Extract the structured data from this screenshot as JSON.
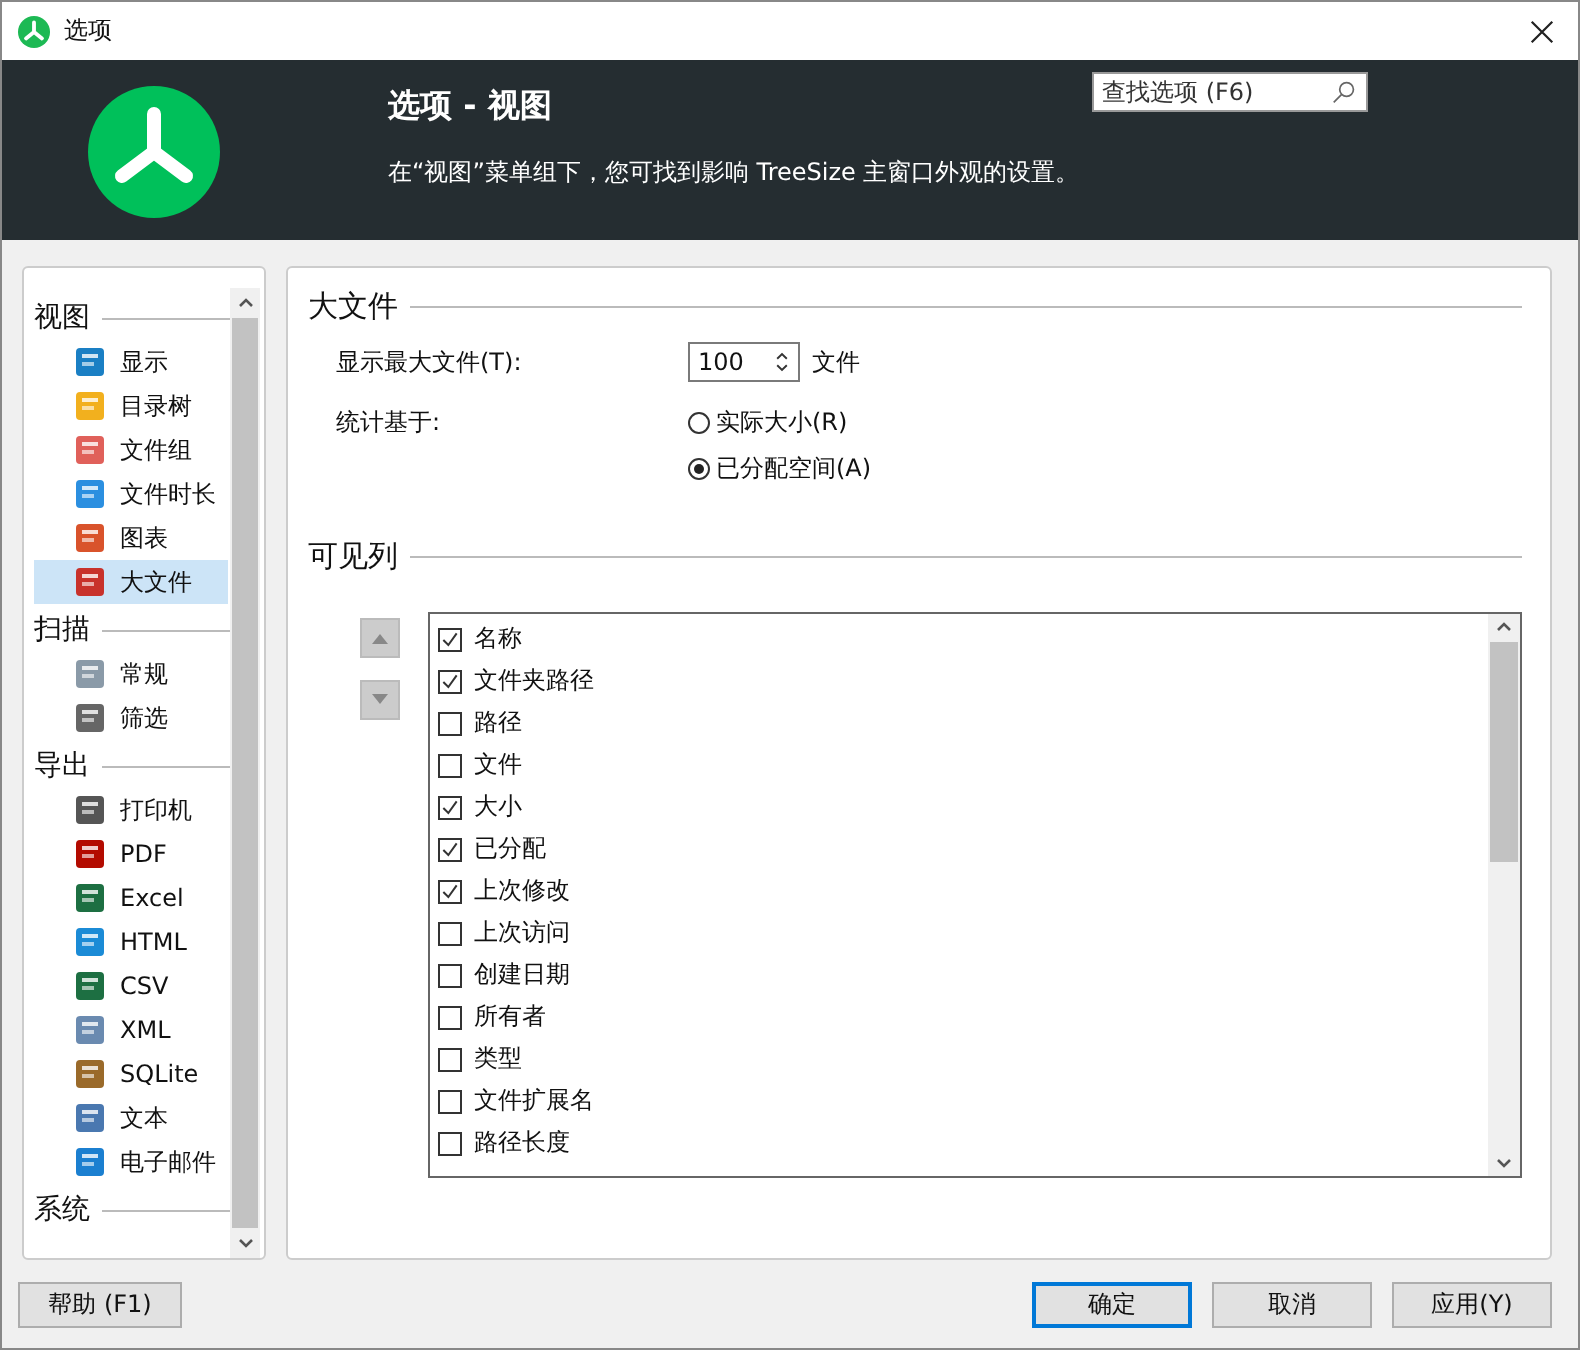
{
  "window": {
    "title": "选项"
  },
  "header": {
    "title": "选项 - 视图",
    "description": "在“视图”菜单组下，您可找到影响 TreeSize 主窗口外观的设置。",
    "search": {
      "placeholder": "查找选项 (F6)"
    }
  },
  "sidebar": {
    "groups": [
      {
        "label": "视图",
        "items": [
          {
            "label": "显示",
            "selected": false
          },
          {
            "label": "目录树",
            "selected": false
          },
          {
            "label": "文件组",
            "selected": false
          },
          {
            "label": "文件时长",
            "selected": false
          },
          {
            "label": "图表",
            "selected": false
          },
          {
            "label": "大文件",
            "selected": true
          }
        ]
      },
      {
        "label": "扫描",
        "items": [
          {
            "label": "常规",
            "selected": false
          },
          {
            "label": "筛选",
            "selected": false
          }
        ]
      },
      {
        "label": "导出",
        "items": [
          {
            "label": "打印机",
            "selected": false
          },
          {
            "label": "PDF",
            "selected": false
          },
          {
            "label": "Excel",
            "selected": false
          },
          {
            "label": "HTML",
            "selected": false
          },
          {
            "label": "CSV",
            "selected": false
          },
          {
            "label": "XML",
            "selected": false
          },
          {
            "label": "SQLite",
            "selected": false
          },
          {
            "label": "文本",
            "selected": false
          },
          {
            "label": "电子邮件",
            "selected": false
          }
        ]
      },
      {
        "label": "系统"
      }
    ]
  },
  "large_files": {
    "title": "大文件",
    "max_label": "显示最大文件(T):",
    "max_value": "100",
    "max_unit": "文件",
    "basis_label": "统计基于:",
    "basis_options": [
      {
        "label": "实际大小(R)",
        "selected": false
      },
      {
        "label": "已分配空间(A)",
        "selected": true
      }
    ]
  },
  "visible_columns": {
    "title": "可见列",
    "items": [
      {
        "label": "名称",
        "checked": true
      },
      {
        "label": "文件夹路径",
        "checked": true
      },
      {
        "label": "路径",
        "checked": false
      },
      {
        "label": "文件",
        "checked": false
      },
      {
        "label": "大小",
        "checked": true
      },
      {
        "label": "已分配",
        "checked": true
      },
      {
        "label": "上次修改",
        "checked": true
      },
      {
        "label": "上次访问",
        "checked": false
      },
      {
        "label": "创建日期",
        "checked": false
      },
      {
        "label": "所有者",
        "checked": false
      },
      {
        "label": "类型",
        "checked": false
      },
      {
        "label": "文件扩展名",
        "checked": false
      },
      {
        "label": "路径长度",
        "checked": false
      }
    ]
  },
  "buttons": {
    "help": "帮助 (F1)",
    "ok": "确定",
    "cancel": "取消",
    "apply": "应用(Y)"
  }
}
